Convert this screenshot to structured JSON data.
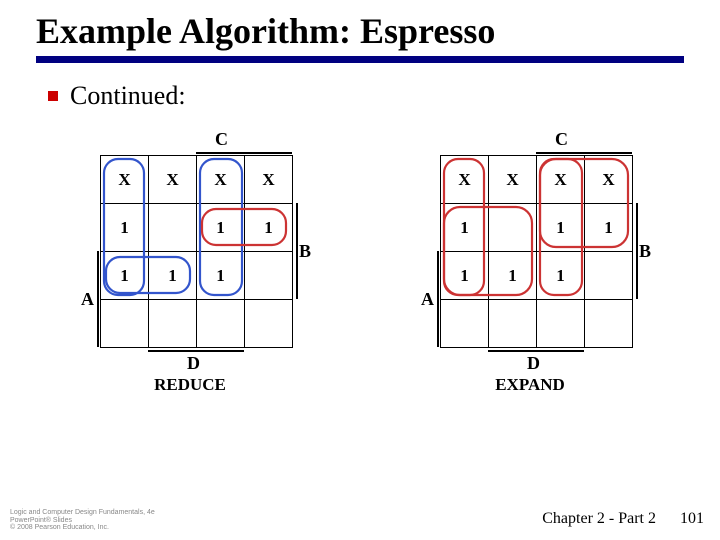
{
  "title": "Example Algorithm: Espresso",
  "bullet": "Continued:",
  "labels": {
    "C": "C",
    "B": "B",
    "A": "A",
    "D": "D"
  },
  "kmap1": {
    "caption": "REDUCE",
    "cells": [
      [
        "X",
        "X",
        "X",
        "X"
      ],
      [
        "1",
        "",
        "1",
        "1"
      ],
      [
        "1",
        "1",
        "1",
        ""
      ],
      [
        "",
        "",
        "",
        ""
      ]
    ]
  },
  "kmap2": {
    "caption": "EXPAND",
    "cells": [
      [
        "X",
        "X",
        "X",
        "X"
      ],
      [
        "1",
        "",
        "1",
        "1"
      ],
      [
        "1",
        "1",
        "1",
        ""
      ],
      [
        "",
        "",
        "",
        ""
      ]
    ]
  },
  "footer": {
    "line1": "Logic and Computer Design Fundamentals, 4e",
    "line2": "PowerPoint® Slides",
    "line3": "© 2008 Pearson Education, Inc."
  },
  "chapter": "Chapter 2 - Part 2",
  "page": "101"
}
